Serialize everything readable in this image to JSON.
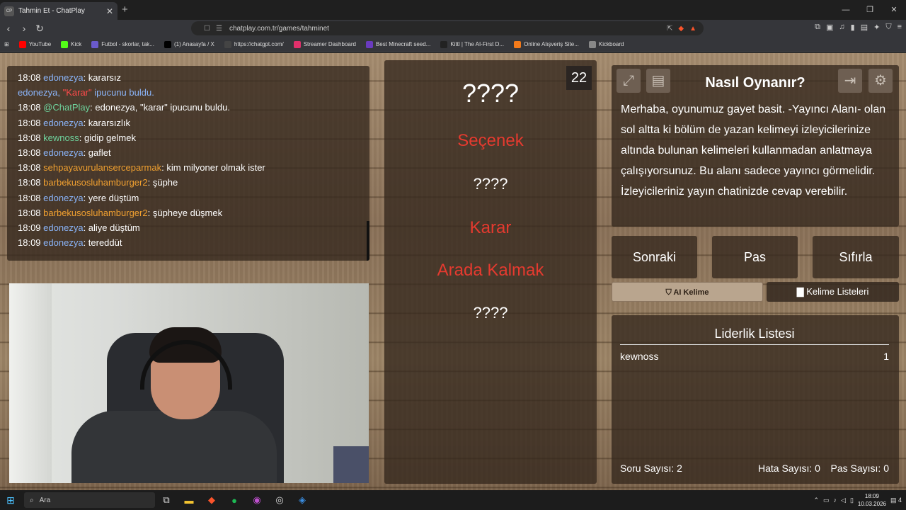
{
  "browser": {
    "tab_title": "Tahmin Et - ChatPlay",
    "tab_favicon": "CP",
    "url": "chatplay.com.tr/games/tahminet",
    "window_controls": [
      "—",
      "❐",
      "✕"
    ]
  },
  "bookmarks": [
    {
      "label": "YouTube",
      "color": "#ff0000"
    },
    {
      "label": "Kick",
      "color": "#53fc18"
    },
    {
      "label": "Futbol - skorlar, tak...",
      "color": "#6a5acd"
    },
    {
      "label": "(1) Anasayfa / X",
      "color": "#000000"
    },
    {
      "label": "https://chatgpt.com/",
      "color": "#444444"
    },
    {
      "label": "Streamer Dashboard",
      "color": "#e0306b"
    },
    {
      "label": "Best Minecraft seed...",
      "color": "#6a3bbf"
    },
    {
      "label": "Kittl | The AI-First D...",
      "color": "#222222"
    },
    {
      "label": "Online Alışveriş Site...",
      "color": "#f27a1a"
    },
    {
      "label": "Kickboard",
      "color": "#888888"
    }
  ],
  "chat": [
    {
      "time": "18:08",
      "user": "edonezya",
      "userColor": "blue",
      "text": ": kararsız"
    },
    {
      "time": "",
      "user": "edonezya, ",
      "userColor": "blue",
      "highlight": "\"Karar\"",
      "text": " ipucunu buldu.",
      "textColor": "blue"
    },
    {
      "time": "18:08",
      "user": "@ChatPlay",
      "userColor": "green",
      "text": ": edonezya, \"karar\" ipucunu buldu."
    },
    {
      "time": "18:08",
      "user": "edonezya",
      "userColor": "blue",
      "text": ": kararsızlık"
    },
    {
      "time": "18:08",
      "user": "kewnoss",
      "userColor": "green",
      "text": ": gidip gelmek"
    },
    {
      "time": "18:08",
      "user": "edonezya",
      "userColor": "blue",
      "text": ": gaflet"
    },
    {
      "time": "18:08",
      "user": "sehpayavurulanserceparmak",
      "userColor": "orange",
      "text": ": kim milyoner olmak ister"
    },
    {
      "time": "18:08",
      "user": "barbekusosluhamburger2",
      "userColor": "orange",
      "text": ": şüphe"
    },
    {
      "time": "18:08",
      "user": "edonezya",
      "userColor": "blue",
      "text": ": yere düştüm"
    },
    {
      "time": "18:08",
      "user": "barbekusosluhamburger2",
      "userColor": "orange",
      "text": ": şüpheye düşmek"
    },
    {
      "time": "18:09",
      "user": "edonezya",
      "userColor": "blue",
      "text": ": aliye düştüm"
    },
    {
      "time": "18:09",
      "user": "edonezya",
      "userColor": "blue",
      "text": ": tereddüt"
    }
  ],
  "game": {
    "timer": "22",
    "main_word": "????",
    "words": [
      "Seçenek",
      "????",
      "Karar",
      "Arada Kalmak",
      "????"
    ]
  },
  "help": {
    "title": "Nasıl Oynanır?",
    "text": "Merhaba, oyunumuz gayet basit. -Yayıncı Alanı- olan sol altta ki bölüm de yazan kelimeyi izleyicilerinize altında bulunan kelimeleri kullanmadan anlatmaya çalışıyorsunuz. Bu alanı sadece yayıncı görmelidir. İzleyicileriniz yayın chatinizde cevap verebilir."
  },
  "controls": {
    "next": "Sonraki",
    "pass": "Pas",
    "reset": "Sıfırla",
    "ai_word": "AI Kelime",
    "word_lists": "Kelime Listeleri"
  },
  "leaderboard": {
    "title": "Liderlik Listesi",
    "rows": [
      {
        "name": "kewnoss",
        "score": "1"
      }
    ],
    "stats": {
      "questions": "Soru Sayısı: 2",
      "errors": "Hata Sayısı: 0",
      "passes": "Pas Sayısı: 0"
    }
  },
  "taskbar": {
    "search_placeholder": "Ara",
    "time": "18:09",
    "date": "10.03.2026",
    "notifications": "4"
  },
  "colors": {
    "accent_red": "#e53a2f",
    "user_blue": "#8ab4f8",
    "user_orange": "#f0a030",
    "user_green": "#6fd39d"
  }
}
